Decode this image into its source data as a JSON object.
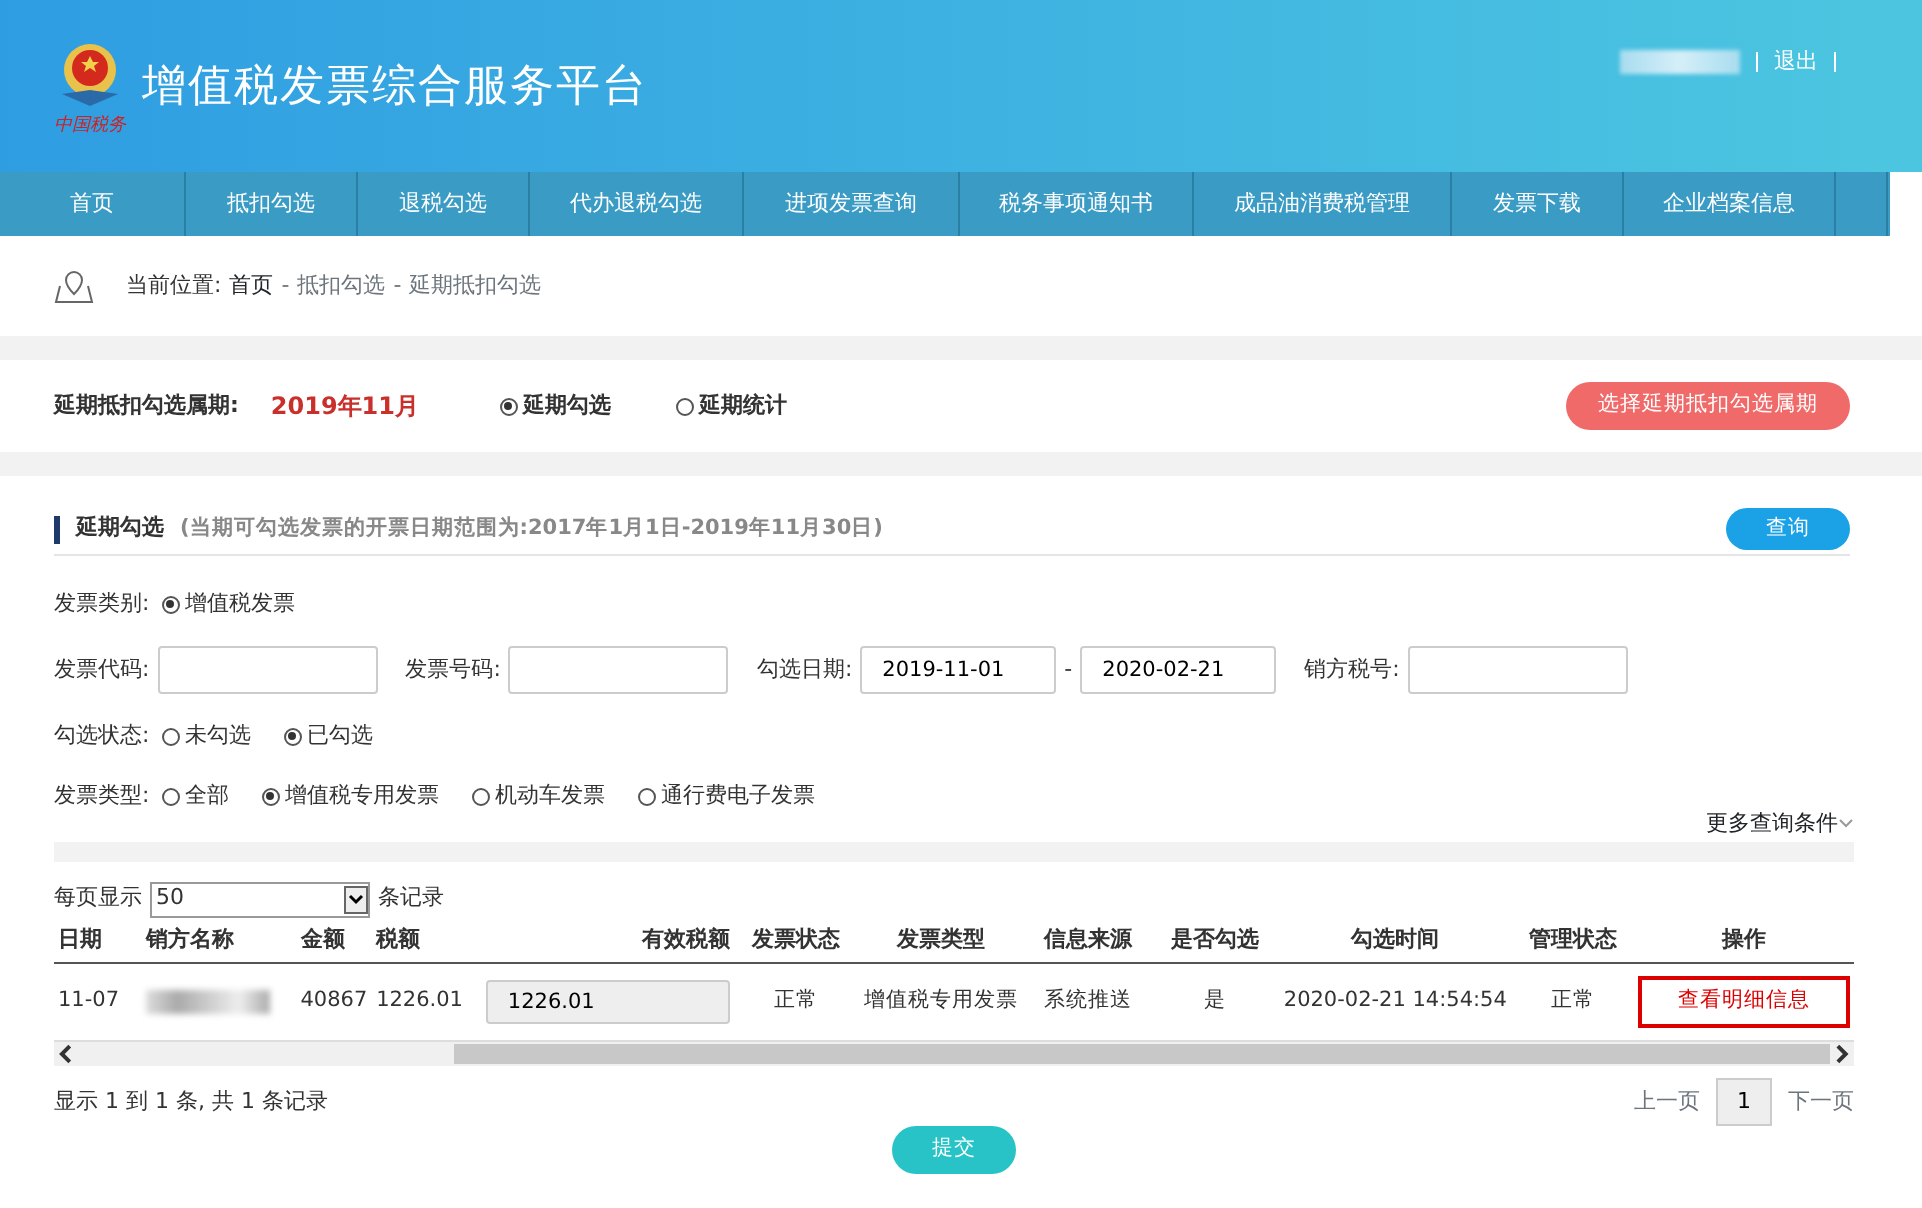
{
  "header": {
    "logo_text": "中国税务",
    "title": "增值税发票综合服务平台",
    "user_links": [
      {
        "label": "退出"
      }
    ]
  },
  "nav": [
    {
      "label": "首页"
    },
    {
      "label": "抵扣勾选"
    },
    {
      "label": "退税勾选"
    },
    {
      "label": "代办退税勾选"
    },
    {
      "label": "进项发票查询"
    },
    {
      "label": "税务事项通知书"
    },
    {
      "label": "成品油消费税管理"
    },
    {
      "label": "发票下载"
    },
    {
      "label": "企业档案信息"
    }
  ],
  "breadcrumb": {
    "label": "当前位置:",
    "items": [
      "首页",
      "抵扣勾选",
      "延期抵扣勾选"
    ],
    "separator": "-"
  },
  "period": {
    "label": "延期抵扣勾选属期:",
    "value": "2019年11月",
    "options": [
      {
        "label": "延期勾选",
        "selected": true
      },
      {
        "label": "延期统计",
        "selected": false
      }
    ],
    "button": "选择延期抵扣勾选属期"
  },
  "section": {
    "title": "延期勾选",
    "note": "(当期可勾选发票的开票日期范围为:2017年1月1日-2019年11月30日)",
    "button": "查询"
  },
  "filters": {
    "category": {
      "label": "发票类别:",
      "options": [
        {
          "label": "增值税发票",
          "selected": true
        }
      ]
    },
    "fields": [
      {
        "label": "发票代码:"
      },
      {
        "label": "发票号码:"
      },
      {
        "label": "勾选日期:",
        "value": "2019-11-01",
        "separator": "-",
        "to": "2020-02-21"
      },
      {
        "label": "销方税号:"
      }
    ],
    "status": {
      "label": "勾选状态:",
      "options": [
        {
          "label": "未勾选",
          "selected": false
        },
        {
          "label": "已勾选",
          "selected": true
        }
      ]
    },
    "type": {
      "label": "发票类型:",
      "options": [
        {
          "label": "全部",
          "selected": false
        },
        {
          "label": "增值税专用发票",
          "selected": true
        },
        {
          "label": "机动车发票",
          "selected": false
        },
        {
          "label": "通行费电子发票",
          "selected": false
        }
      ]
    },
    "more": "更多查询条件"
  },
  "page_size": {
    "label": "每页显示",
    "value": "50",
    "suffix": "条记录"
  },
  "table": {
    "columns": [
      "日期",
      "销方名称",
      "金额",
      "税额",
      "有效税额",
      "发票状态",
      "发票类型",
      "信息来源",
      "是否勾选",
      "勾选时间",
      "管理状态",
      "操作"
    ],
    "rows": [
      {
        "cells": [
          "11-07",
          "",
          "40867",
          "1226.01",
          "1226.01",
          "正常",
          "增值税专用发票",
          "系统推送",
          "是",
          "2020-02-21 14:54:54",
          "正常",
          "查看明细信息"
        ],
        "action_highlighted": true
      }
    ]
  },
  "summary": "显示 1 到 1 条, 共 1 条记录",
  "pagination": {
    "prev": "上一页",
    "pages": [
      {
        "label": "1",
        "selected": true
      }
    ],
    "next": "下一页"
  },
  "submit": "提交"
}
